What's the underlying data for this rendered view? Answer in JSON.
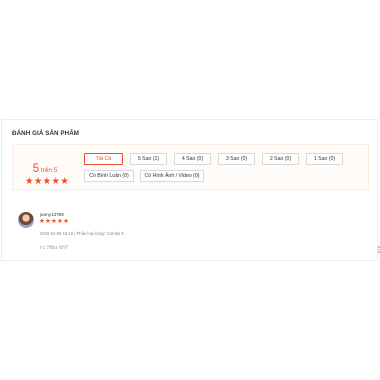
{
  "section": {
    "title": "ĐÁNH GIÁ SẢN PHẨM"
  },
  "overview": {
    "score": "5",
    "score_suffix": " trên 5",
    "stars": 5
  },
  "filters": [
    {
      "label": "Tất Cả",
      "active": true
    },
    {
      "label": "5 Sao (1)",
      "active": false
    },
    {
      "label": "4 Sao (0)",
      "active": false
    },
    {
      "label": "3 Sao (0)",
      "active": false
    },
    {
      "label": "2 Sao (0)",
      "active": false
    },
    {
      "label": "1 Sao (0)",
      "active": false
    },
    {
      "label": "Có Bình Luận (0)",
      "active": false
    },
    {
      "label": "Có Hình Ảnh / Video (0)",
      "active": false
    }
  ],
  "review": {
    "username": "janny13789",
    "stars": 5,
    "meta": "2026-01-06 15:16 | Phân loại hàng: Combo 8",
    "helpful": "Hữu ích?"
  },
  "colors": {
    "accent": "#ee4d2d"
  },
  "icons": {
    "helpful": "thumbs-up-icon",
    "more": "more-vertical-icon"
  }
}
